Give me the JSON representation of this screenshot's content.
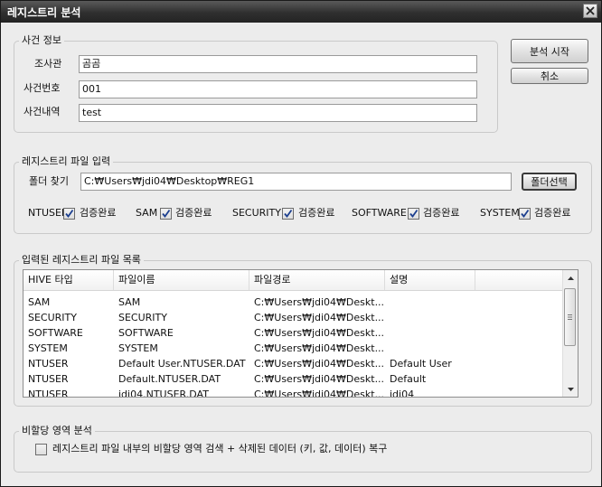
{
  "window": {
    "title": "레지스트리 분석"
  },
  "case_info": {
    "legend": "사건 정보",
    "investigator_label": "조사관",
    "investigator_value": "곰곰",
    "case_number_label": "사건번호",
    "case_number_value": "001",
    "case_desc_label": "사건내역",
    "case_desc_value": "test"
  },
  "actions": {
    "start_label": "분석 시작",
    "cancel_label": "취소"
  },
  "registry_input": {
    "legend": "레지스트리 파일 입력",
    "folder_label": "폴더 찾기",
    "folder_value": "C:₩Users₩jdi04₩Desktop₩REG1",
    "select_label": "폴더선택",
    "files": [
      {
        "name": "NTUSER",
        "status": "검증완료",
        "checked": true
      },
      {
        "name": "SAM",
        "status": "검증완료",
        "checked": true
      },
      {
        "name": "SECURITY",
        "status": "검증완료",
        "checked": true
      },
      {
        "name": "SOFTWARE",
        "status": "검증완료",
        "checked": true
      },
      {
        "name": "SYSTEM",
        "status": "검증완료",
        "checked": true
      }
    ]
  },
  "file_list": {
    "legend": "입력된 레지스트리 파일 목록",
    "columns": [
      "HIVE 타입",
      "파일이름",
      "파일경로",
      "설명"
    ],
    "rows": [
      [
        "SAM",
        "SAM",
        "C:₩Users₩jdi04₩Deskt...",
        ""
      ],
      [
        "SECURITY",
        "SECURITY",
        "C:₩Users₩jdi04₩Deskt...",
        ""
      ],
      [
        "SOFTWARE",
        "SOFTWARE",
        "C:₩Users₩jdi04₩Deskt...",
        ""
      ],
      [
        "SYSTEM",
        "SYSTEM",
        "C:₩Users₩jdi04₩Deskt...",
        ""
      ],
      [
        "NTUSER",
        "Default User.NTUSER.DAT",
        "C:₩Users₩jdi04₩Deskt...",
        "Default User"
      ],
      [
        "NTUSER",
        "Default.NTUSER.DAT",
        "C:₩Users₩jdi04₩Deskt...",
        "Default"
      ],
      [
        "NTUSER",
        "jdi04.NTUSER.DAT",
        "C:₩Users₩jdi04₩Deskt...",
        "jdi04"
      ]
    ]
  },
  "unallocated": {
    "legend": "비할당 영역 분석",
    "option_label": "레지스트리 파일 내부의 비할당 영역 검색 + 삭제된 데이터 (키, 값, 데이터) 복구",
    "option_checked": false
  },
  "colors": {
    "title_bar": "#2f2f2f",
    "window_bg": "#ececec",
    "check_mark": "#1c3f8f"
  }
}
